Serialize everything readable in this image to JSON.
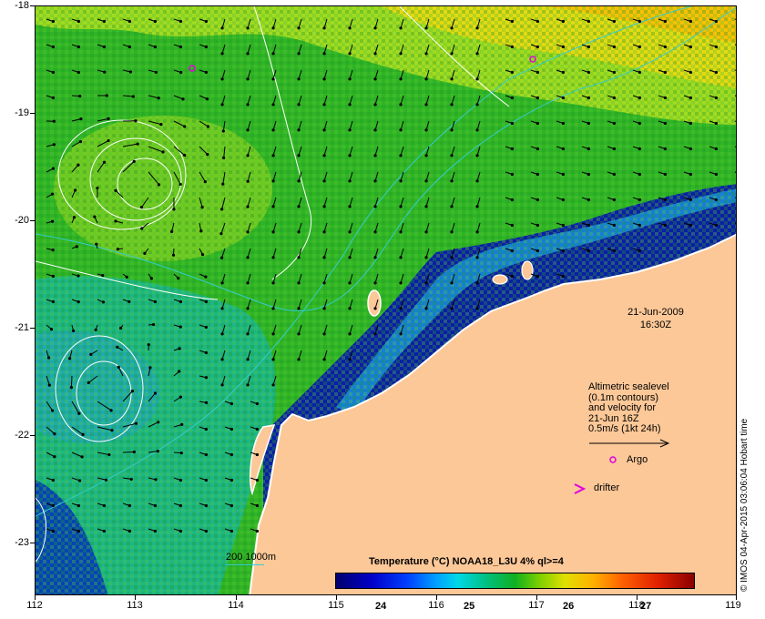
{
  "map": {
    "y_axis_labels": [
      "-18",
      "-19",
      "-20",
      "-21",
      "-22",
      "-23"
    ],
    "x_axis_labels": [
      "112",
      "113",
      "114",
      "115",
      "116",
      "117",
      "118",
      "119"
    ],
    "lat_range": [
      -23.5,
      -18
    ],
    "lon_range": [
      112,
      119
    ],
    "land_color": "#fcc898",
    "contour_color": "#ffffff",
    "bathymetry_color": "#34cccc"
  },
  "annotation": {
    "date": "21-Jun-2009",
    "time": "16:30Z"
  },
  "legend": {
    "lines": [
      "Altimetric sealevel",
      "(0.1m contours)",
      "and velocity for",
      "21-Jun 16Z",
      "0.5m/s (1kt 24h)"
    ],
    "argo_label": "Argo",
    "drifter_label": "drifter",
    "argo_color": "#e000e0",
    "drifter_color": "#e000e0"
  },
  "colorbar": {
    "title": "Temperature (°C) NOAA18_L3U 4% ql>=4",
    "ticks": [
      "24",
      "25",
      "26",
      "27"
    ]
  },
  "bathymetry_legend": "200  1000m",
  "credit": "© IMOS 04-Apr-2015 03:06:04 Hobart time"
}
